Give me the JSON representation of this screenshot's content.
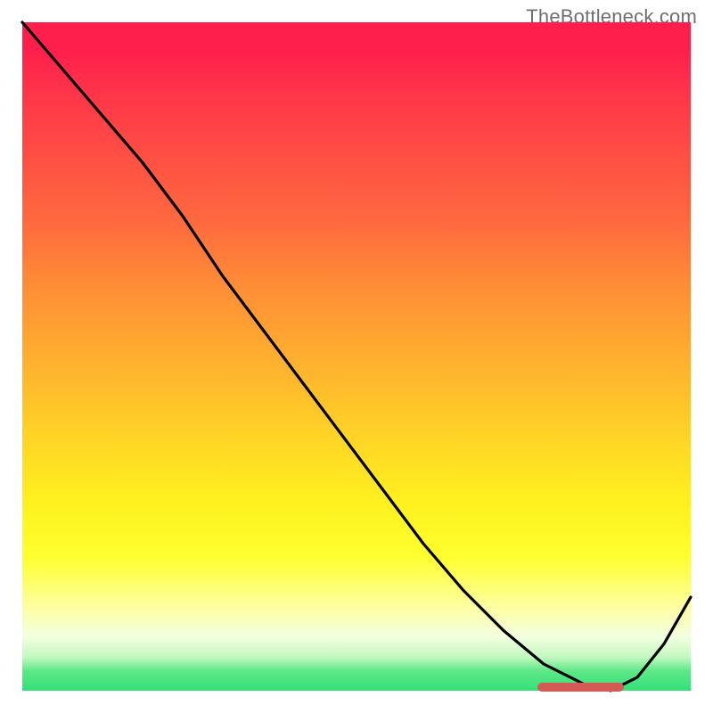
{
  "watermark": "TheBottleneck.com",
  "colors": {
    "frame": "#000000",
    "curve": "#000000",
    "marker": "#d45a56",
    "watermark_text": "#6f6f6f",
    "gradient_top": "#ff1f4d",
    "gradient_bottom": "#33e079"
  },
  "chart_data": {
    "type": "line",
    "title": "",
    "xlabel": "",
    "ylabel": "",
    "xlim": [
      0,
      100
    ],
    "ylim": [
      0,
      100
    ],
    "grid": false,
    "series": [
      {
        "name": "bottleneck-curve",
        "x": [
          0,
          6,
          12,
          18,
          24,
          30,
          36,
          42,
          48,
          54,
          60,
          66,
          72,
          78,
          84,
          88,
          92,
          96,
          100
        ],
        "values": [
          100,
          93,
          86,
          79,
          71,
          62,
          54,
          46,
          38,
          30,
          22,
          15,
          9,
          4,
          1,
          0,
          2,
          7,
          14
        ]
      }
    ],
    "annotations": [
      {
        "name": "optimal-range-marker",
        "x_start": 77,
        "x_end": 90,
        "y": 0.5
      }
    ],
    "background": "vertical-gradient red→orange→yellow→green (top=high bottleneck, bottom=balanced)"
  }
}
